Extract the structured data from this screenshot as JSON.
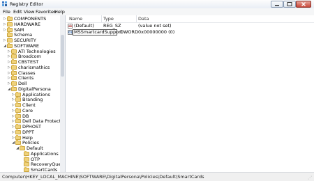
{
  "window": {
    "title": "Registry Editor",
    "accent": "#c8473a"
  },
  "menu": [
    "File",
    "Edit",
    "View",
    "Favorites",
    "Help"
  ],
  "tree": [
    {
      "label": "COMPONENTS",
      "depth": 1,
      "toggle": "collapsed"
    },
    {
      "label": "HARDWARE",
      "depth": 1,
      "toggle": "collapsed"
    },
    {
      "label": "SAM",
      "depth": 1,
      "toggle": "collapsed"
    },
    {
      "label": "Schema",
      "depth": 1,
      "toggle": "none"
    },
    {
      "label": "SECURITY",
      "depth": 1,
      "toggle": "collapsed"
    },
    {
      "label": "SOFTWARE",
      "depth": 1,
      "toggle": "expanded"
    },
    {
      "label": "ATI Technologies",
      "depth": 2,
      "toggle": "collapsed"
    },
    {
      "label": "Broadcom",
      "depth": 2,
      "toggle": "collapsed"
    },
    {
      "label": "CBSTEST",
      "depth": 2,
      "toggle": "collapsed"
    },
    {
      "label": "charismathics",
      "depth": 2,
      "toggle": "collapsed"
    },
    {
      "label": "Classes",
      "depth": 2,
      "toggle": "collapsed"
    },
    {
      "label": "Clients",
      "depth": 2,
      "toggle": "collapsed"
    },
    {
      "label": "Dell",
      "depth": 2,
      "toggle": "collapsed"
    },
    {
      "label": "DigitalPersona",
      "depth": 2,
      "toggle": "expanded"
    },
    {
      "label": "Applications",
      "depth": 3,
      "toggle": "collapsed"
    },
    {
      "label": "Branding",
      "depth": 3,
      "toggle": "collapsed"
    },
    {
      "label": "Client",
      "depth": 3,
      "toggle": "collapsed"
    },
    {
      "label": "Core",
      "depth": 3,
      "toggle": "collapsed"
    },
    {
      "label": "DB",
      "depth": 3,
      "toggle": "collapsed"
    },
    {
      "label": "Dell Data Protection",
      "depth": 3,
      "toggle": "collapsed"
    },
    {
      "label": "DPHOST",
      "depth": 3,
      "toggle": "collapsed"
    },
    {
      "label": "DPPT",
      "depth": 3,
      "toggle": "collapsed"
    },
    {
      "label": "Help",
      "depth": 3,
      "toggle": "collapsed"
    },
    {
      "label": "Policies",
      "depth": 3,
      "toggle": "expanded"
    },
    {
      "label": "Default",
      "depth": 4,
      "toggle": "expanded"
    },
    {
      "label": "Applications",
      "depth": 5,
      "toggle": "none"
    },
    {
      "label": "OTP",
      "depth": 5,
      "toggle": "none"
    },
    {
      "label": "RecoveryQuesti",
      "depth": 5,
      "toggle": "none"
    },
    {
      "label": "SmartCards",
      "depth": 5,
      "toggle": "none"
    }
  ],
  "list": {
    "columns": [
      "Name",
      "Type",
      "Data"
    ],
    "rows": [
      {
        "icon": "ab",
        "name": "(Default)",
        "type": "REG_SZ",
        "data": "(value not set)"
      },
      {
        "icon": "01",
        "name": "MSSmartcardSupport",
        "type": "DWORD",
        "data": "0x00000000 (0)"
      }
    ]
  },
  "status": "Computer\\HKEY_LOCAL_MACHINE\\SOFTWARE\\DigitalPersona\\Policies\\Default\\SmartCards"
}
